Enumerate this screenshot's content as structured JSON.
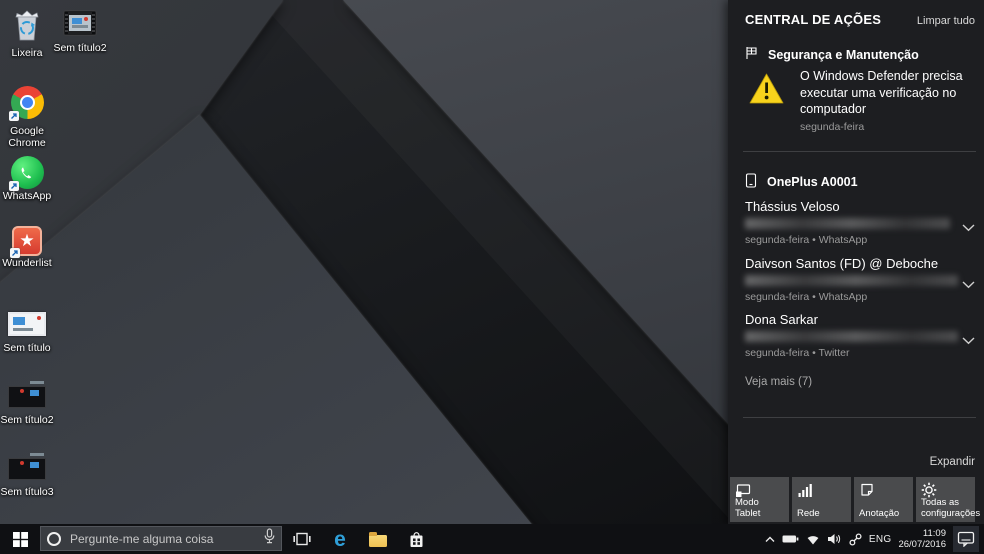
{
  "glyphs": {
    "edge": "e",
    "star": "★"
  },
  "desktop": {
    "icons": [
      {
        "label": "Lixeira"
      },
      {
        "label": "Sem título2"
      },
      {
        "label": "Google Chrome"
      },
      {
        "label": "WhatsApp"
      },
      {
        "label": "Wunderlist"
      },
      {
        "label": "Sem título"
      },
      {
        "label": "Sem título2"
      },
      {
        "label": "Sem título3"
      }
    ]
  },
  "action_center": {
    "title": "CENTRAL DE AÇÕES",
    "clear_all": "Limpar tudo",
    "security": {
      "title": "Segurança e Manutenção",
      "notification": {
        "text": "O Windows Defender precisa executar uma verificação no computador",
        "meta": "segunda-feira"
      }
    },
    "phone": {
      "title": "OnePlus A0001",
      "notifications": [
        {
          "title": "Thássius Veloso",
          "meta": "segunda-feira • WhatsApp"
        },
        {
          "title": "Daivson Santos (FD) @ Deboche",
          "meta": "segunda-feira • WhatsApp"
        },
        {
          "title": "Dona Sarkar",
          "meta": "segunda-feira • Twitter"
        }
      ],
      "see_more": "Veja mais (7)"
    },
    "expand": "Expandir",
    "quick_actions": [
      {
        "label": "Modo Tablet"
      },
      {
        "label": "Rede"
      },
      {
        "label": "Anotação"
      },
      {
        "label": "Todas as configurações"
      }
    ],
    "colors": {
      "warning": "#f8d31c",
      "panel_bg": "#1d1e21",
      "tile_bg": "#4a4b4d"
    }
  },
  "taskbar": {
    "search_placeholder": "Pergunte-me alguma coisa",
    "tray": {
      "language": "ENG",
      "time": "11:09",
      "date": "26/07/2016"
    }
  }
}
